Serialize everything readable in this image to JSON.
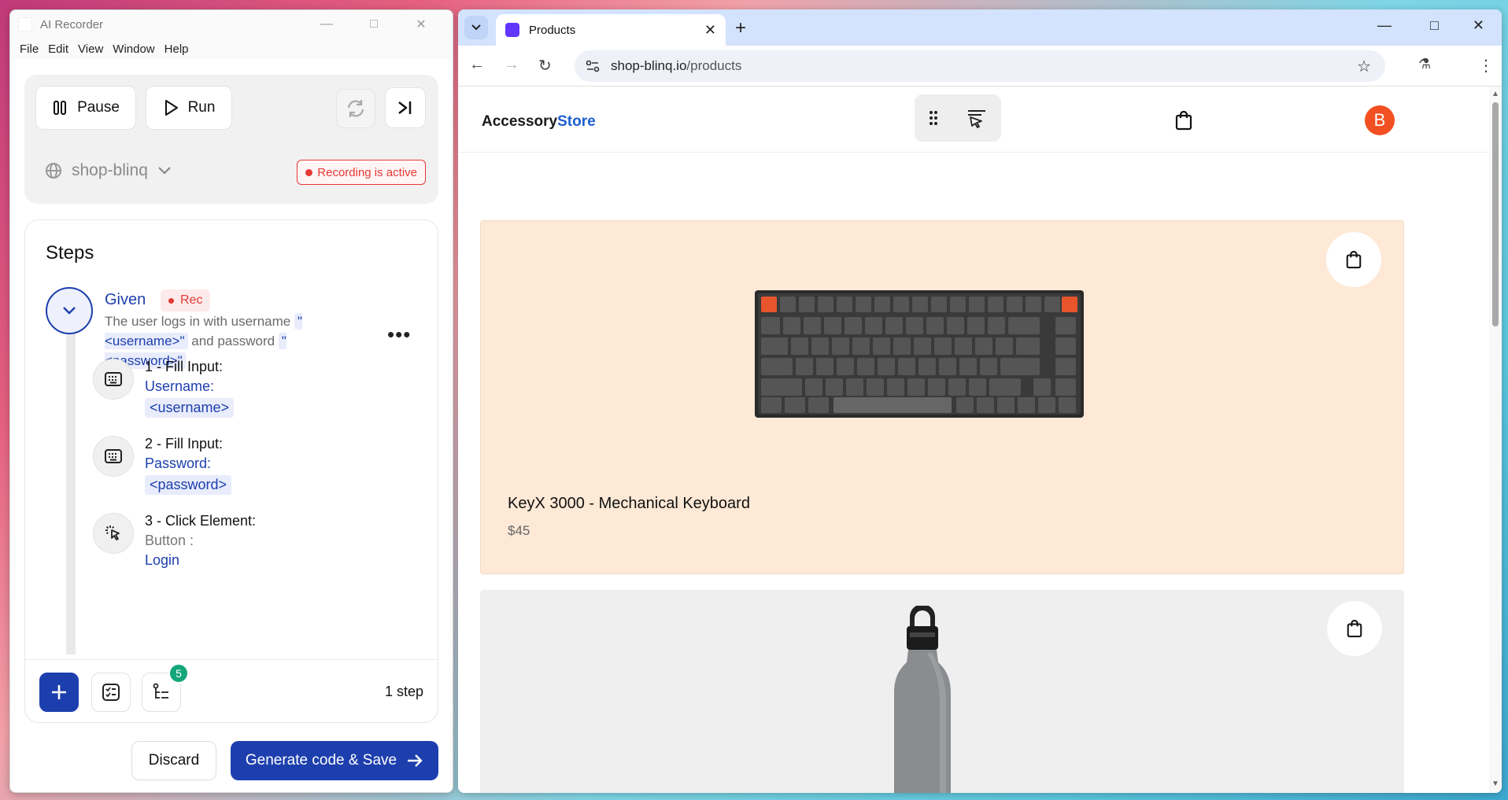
{
  "recorder": {
    "title": "AI Recorder",
    "menu": [
      "File",
      "Edit",
      "View",
      "Window",
      "Help"
    ],
    "pause_label": "Pause",
    "run_label": "Run",
    "site": "shop-blinq",
    "recording_status": "Recording is active",
    "steps_title": "Steps",
    "given_keyword": "Given",
    "rec_chip": "Rec",
    "given_text_1": "The user logs in with username",
    "param_username": "\"<username>\"",
    "given_text_2": "and password",
    "param_password": "\"<password>\"",
    "steps": [
      {
        "head": "1 - Fill Input:",
        "label": "Username:",
        "value": "<username>",
        "icon": "keyboard-icon"
      },
      {
        "head": "2 - Fill Input:",
        "label": "Password:",
        "value": "<password>",
        "icon": "keyboard-icon"
      },
      {
        "head": "3 - Click Element:",
        "label": "Button :",
        "value": "Login",
        "icon": "click-icon"
      }
    ],
    "badge_count": "5",
    "step_count": "1 step",
    "discard_label": "Discard",
    "save_label": "Generate code & Save"
  },
  "browser": {
    "tab_title": "Products",
    "url_host": "shop-blinq.io",
    "url_path": "/products"
  },
  "site": {
    "logo_part1": "Accessory",
    "logo_part2": "Store",
    "avatar_letter": "B",
    "products": [
      {
        "name": "KeyX 3000 - Mechanical Keyboard",
        "price": "$45"
      }
    ]
  },
  "colors": {
    "primary": "#1d3fae",
    "recording": "#e53935",
    "product_bg": "#fde9d6",
    "avatar": "#f25022"
  }
}
